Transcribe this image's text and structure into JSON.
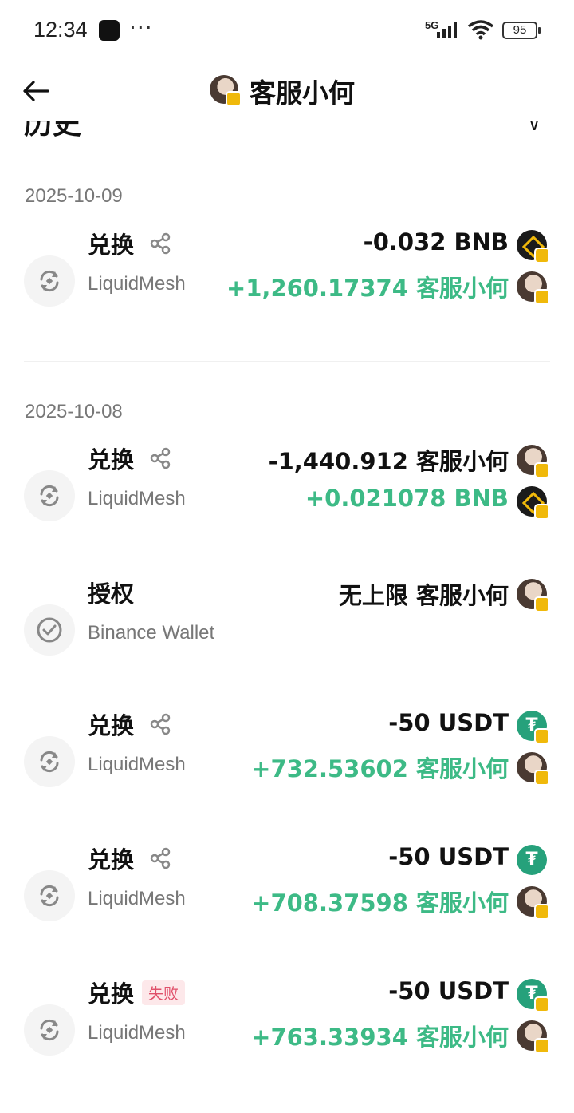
{
  "status_bar": {
    "time": "12:34",
    "dots": "···",
    "network": "5G",
    "battery": "95"
  },
  "header": {
    "title": "客服小何"
  },
  "section": {
    "title": "历史",
    "filter_icon": "filter-icon"
  },
  "groups": [
    {
      "date": "2025-10-09",
      "items": [
        {
          "type": "兑换",
          "source": "LiquidMesh",
          "share": true,
          "failed": false,
          "out": "-0.032 BNB",
          "out_token": "bnb",
          "in": "+1,260.17374 客服小何",
          "in_token": "custom"
        }
      ]
    },
    {
      "date": "2025-10-08",
      "items": [
        {
          "type": "兑换",
          "source": "LiquidMesh",
          "share": true,
          "failed": false,
          "out": "-1,440.912 客服小何",
          "out_token": "custom",
          "in": "+0.021078 BNB",
          "in_token": "bnb"
        },
        {
          "type": "授权",
          "source": "Binance Wallet",
          "share": false,
          "failed": false,
          "out": "无上限 客服小何",
          "out_token": "custom",
          "in": null,
          "in_token": null
        },
        {
          "type": "兑换",
          "source": "LiquidMesh",
          "share": true,
          "failed": false,
          "out": "-50 USDT",
          "out_token": "usdt",
          "in": "+732.53602 客服小何",
          "in_token": "custom"
        },
        {
          "type": "兑换",
          "source": "LiquidMesh",
          "share": true,
          "failed": false,
          "out": "-50 USDT",
          "out_token": "usdt",
          "in": "+708.37598 客服小何",
          "in_token": "custom"
        },
        {
          "type": "兑换",
          "source": "LiquidMesh",
          "share": false,
          "failed": true,
          "fail_label": "失败",
          "out": "-50 USDT",
          "out_token": "usdt",
          "in": "+763.33934 客服小何",
          "in_token": "custom"
        }
      ]
    }
  ],
  "colors": {
    "positive": "#3dba86",
    "negative": "#111111",
    "fail_bg": "#fde8ea",
    "fail_text": "#e0506a",
    "bnb": "#f0b90b",
    "usdt": "#26a17b"
  }
}
